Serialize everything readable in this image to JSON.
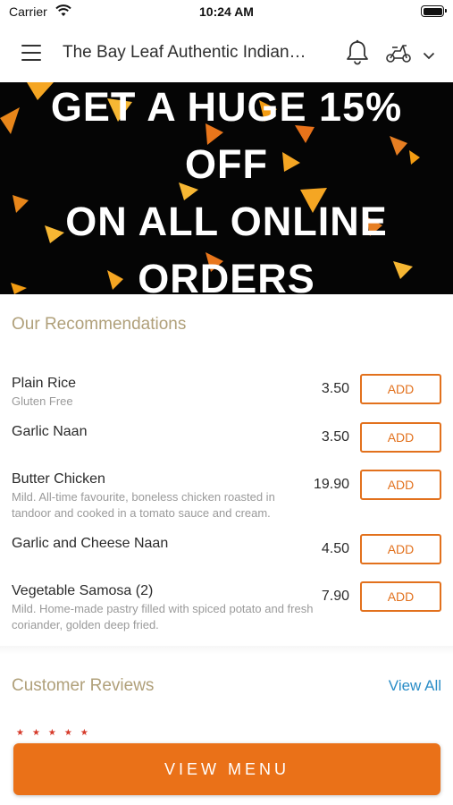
{
  "status_bar": {
    "carrier": "Carrier",
    "time": "10:24 AM",
    "icons": [
      "wifi-icon",
      "battery-icon"
    ]
  },
  "header": {
    "title": "The Bay Leaf Authentic Indian…",
    "icons": [
      "menu-icon",
      "bell-icon",
      "scooter-icon",
      "chevron-down-icon"
    ]
  },
  "banner": {
    "lines": [
      "GET A HUGE 15%",
      "OFF",
      "ON ALL ONLINE",
      "ORDERS"
    ]
  },
  "recommendations": {
    "title": "Our Recommendations",
    "items": [
      {
        "name": "Plain Rice",
        "description": "Gluten Free",
        "price": "3.50",
        "button": "ADD"
      },
      {
        "name": "Garlic Naan",
        "description": "",
        "price": "3.50",
        "button": "ADD"
      },
      {
        "name": "Butter Chicken",
        "description": "Mild. All-time favourite, boneless chicken roasted in tandoor and cooked in a tomato sauce and cream.",
        "price": "19.90",
        "button": "ADD"
      },
      {
        "name": "Garlic and Cheese Naan",
        "description": "",
        "price": "4.50",
        "button": "ADD"
      },
      {
        "name": "Vegetable Samosa (2)",
        "description": "Mild. Home-made pastry filled with spiced potato and fresh coriander, golden deep fried.",
        "price": "7.90",
        "button": "ADD"
      }
    ]
  },
  "reviews": {
    "title": "Customer Reviews",
    "view_all": "View All",
    "stars": "★★★★★"
  },
  "footer": {
    "button": "VIEW MENU"
  },
  "colors": {
    "accent": "#ea7118",
    "section_title": "#b0a07a",
    "link": "#2a8dc7",
    "banner_bg": "#050505"
  }
}
